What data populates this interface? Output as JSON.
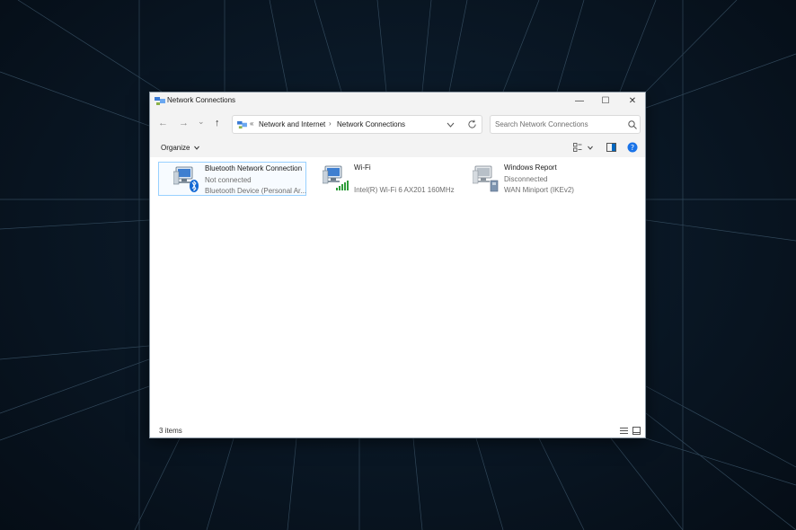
{
  "window": {
    "title": "Network Connections",
    "controls": {
      "minimize": "—",
      "maximize": "☐",
      "close": "✕"
    }
  },
  "nav": {
    "back": "←",
    "forward": "→",
    "recent": "⌄",
    "up": "↑"
  },
  "address_bar": {
    "crumbs": [
      "Network and Internet",
      "Network Connections"
    ],
    "separator": "›",
    "overflow": "«"
  },
  "search": {
    "placeholder": "Search Network Connections"
  },
  "command_bar": {
    "organize_label": "Organize"
  },
  "connections": [
    {
      "name": "Bluetooth Network Connection",
      "status": "Not connected",
      "device": "Bluetooth Device (Personal Ar...",
      "icon": "bluetooth-network-icon",
      "selected": true
    },
    {
      "name": "Wi-Fi",
      "status": "",
      "device": "Intel(R) Wi-Fi 6 AX201 160MHz",
      "icon": "wifi-network-icon",
      "selected": false
    },
    {
      "name": "Windows Report",
      "status": "Disconnected",
      "device": "WAN Miniport (IKEv2)",
      "icon": "vpn-network-icon",
      "selected": false
    }
  ],
  "status_bar": {
    "item_count": "3 items"
  },
  "colors": {
    "accent": "#0067c0",
    "help": "#1a73e8",
    "selection_border": "#99d1ff",
    "wifi_signal": "#2e9d3a"
  }
}
